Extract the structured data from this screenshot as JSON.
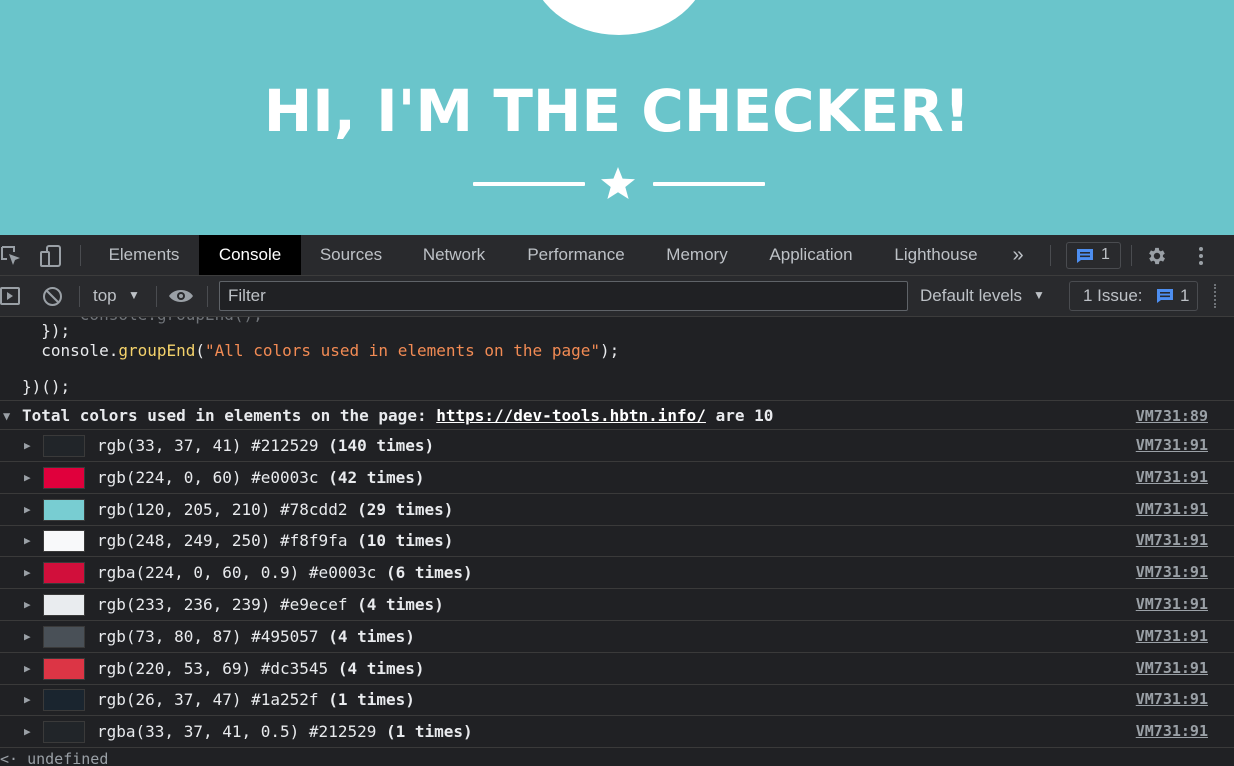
{
  "hero": {
    "title": "HI, I'M THE CHECKER!"
  },
  "devtools": {
    "tabs": [
      "Elements",
      "Console",
      "Sources",
      "Network",
      "Performance",
      "Memory",
      "Application",
      "Lighthouse"
    ],
    "active_tab": "Console",
    "more_tabs": "»",
    "issue_count": "1",
    "toolbar": {
      "context": "top",
      "filter_placeholder": "Filter",
      "levels": "Default levels",
      "issues_label": "1 Issue:",
      "issues_count": "1"
    }
  },
  "console": {
    "code_lines": [
      "  });",
      "  console.groupEnd(\"All colors used in elements on the page\");",
      "",
      "})();"
    ],
    "group": {
      "prefix": "Total colors used in elements on the page: ",
      "link": "https://dev-tools.hbtn.info/",
      "suffix": " are 10",
      "source": "VM731:89"
    },
    "rows": [
      {
        "text": "rgb(33, 37, 41) #212529 ",
        "count": "(140 times)",
        "color": "#212529",
        "source": "VM731:91"
      },
      {
        "text": "rgb(224, 0, 60) #e0003c ",
        "count": "(42 times)",
        "color": "#e0003c",
        "source": "VM731:91"
      },
      {
        "text": "rgb(120, 205, 210) #78cdd2 ",
        "count": "(29 times)",
        "color": "#78cdd2",
        "source": "VM731:91"
      },
      {
        "text": "rgb(248, 249, 250) #f8f9fa ",
        "count": "(10 times)",
        "color": "#f8f9fa",
        "source": "VM731:91"
      },
      {
        "text": "rgba(224, 0, 60, 0.9) #e0003c ",
        "count": "(6 times)",
        "color": "#d10f3b",
        "source": "VM731:91"
      },
      {
        "text": "rgb(233, 236, 239) #e9ecef ",
        "count": "(4 times)",
        "color": "#e9ecef",
        "source": "VM731:91"
      },
      {
        "text": "rgb(73, 80, 87) #495057 ",
        "count": "(4 times)",
        "color": "#495057",
        "source": "VM731:91"
      },
      {
        "text": "rgb(220, 53, 69) #dc3545 ",
        "count": "(4 times)",
        "color": "#dc3545",
        "source": "VM731:91"
      },
      {
        "text": "rgb(26, 37, 47) #1a252f ",
        "count": "(1 times)",
        "color": "#1a252f",
        "source": "VM731:91"
      },
      {
        "text": "rgba(33, 37, 41, 0.5) #212529 ",
        "count": "(1 times)",
        "color": "#212529",
        "source": "VM731:91"
      }
    ],
    "result": "undefined",
    "result_arrow": "<·"
  },
  "colors": {
    "hero_bg": "#6ac5cb",
    "devtools_bg": "#292a2d",
    "console_bg": "#202124",
    "accent_blue": "#1a73e8"
  }
}
